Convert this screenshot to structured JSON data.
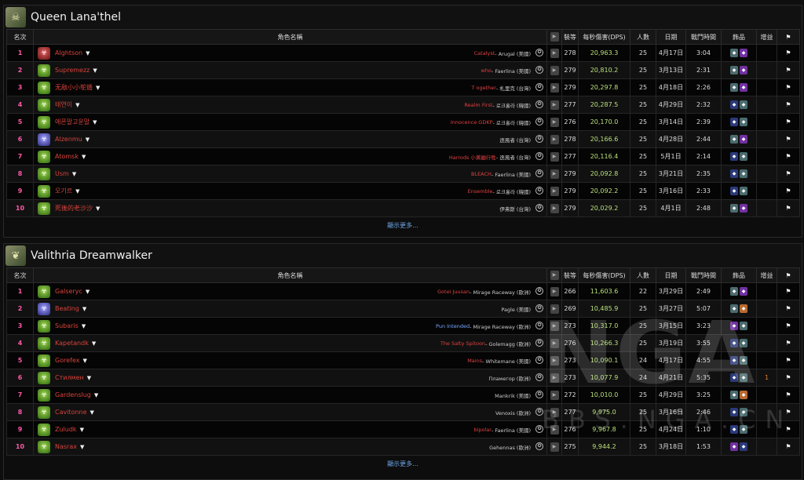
{
  "columns": {
    "rank": "名次",
    "name": "角色名稱",
    "video_icon": "youtube-icon",
    "ilvl": "裝等",
    "dps": "每秒傷害(DPS)",
    "players": "人數",
    "date": "日期",
    "duration": "戰鬥時間",
    "trinkets": "飾品",
    "buff": "增益",
    "flag_icon": "flag-icon"
  },
  "show_more": "顯示更多...",
  "watermark": {
    "big": "NGA",
    "small": "BBS.NGA.CN"
  },
  "bosses": [
    {
      "title": "Queen Lana'thel",
      "rows": [
        {
          "rank": "1",
          "name": "Alghtson",
          "spec": "red",
          "guild": "Catalyst",
          "realm": " - Arugal (美國)",
          "ilvl": "278",
          "dps": "20,963.3",
          "players": "25",
          "date": "4月17日",
          "duration": "3:04",
          "gems": [
            "g-teal",
            "g-purple"
          ],
          "buff": ""
        },
        {
          "rank": "2",
          "name": "Supremezz",
          "spec": "green",
          "guild": "who",
          "realm": " - Faerlina (美國)",
          "ilvl": "279",
          "dps": "20,810.2",
          "players": "25",
          "date": "3月13日",
          "duration": "2:31",
          "gems": [
            "g-teal",
            "g-purple"
          ],
          "buff": ""
        },
        {
          "rank": "3",
          "name": "无敌小小鸵循",
          "spec": "green",
          "guild": "T ogether",
          "realm": " - 札里克 (台灣)",
          "ilvl": "279",
          "dps": "20,297.8",
          "players": "25",
          "date": "4月18日",
          "duration": "2:26",
          "gems": [
            "g-teal",
            "g-purple"
          ],
          "buff": ""
        },
        {
          "rank": "4",
          "name": "태연이",
          "spec": "green",
          "guild": "Realm First",
          "realm": " - 로크홀라 (韓國)",
          "ilvl": "277",
          "dps": "20,287.5",
          "players": "25",
          "date": "4月29日",
          "duration": "2:32",
          "gems": [
            "g-blue",
            "g-teal"
          ],
          "buff": ""
        },
        {
          "rank": "5",
          "name": "에픈말고운말",
          "spec": "green",
          "guild": "Innocence GDKP",
          "realm": " - 로크홀라 (韓國)",
          "ilvl": "276",
          "dps": "20,170.0",
          "players": "25",
          "date": "3月14日",
          "duration": "2:39",
          "gems": [
            "g-blue",
            "g-teal"
          ],
          "buff": ""
        },
        {
          "rank": "6",
          "name": "Alzenmu",
          "spec": "blue",
          "guild": "",
          "realm": "逐風者 (台灣)",
          "ilvl": "278",
          "dps": "20,166.6",
          "players": "25",
          "date": "4月28日",
          "duration": "2:44",
          "gems": [
            "g-teal",
            "g-purple"
          ],
          "buff": ""
        },
        {
          "rank": "7",
          "name": "Atomsk",
          "spec": "green",
          "guild": "Harrods 小黃鼬行牲",
          "realm": " - 逐風者 (台灣)",
          "ilvl": "277",
          "dps": "20,116.4",
          "players": "25",
          "date": "5月1日",
          "duration": "2:14",
          "gems": [
            "g-blue",
            "g-teal"
          ],
          "buff": ""
        },
        {
          "rank": "8",
          "name": "Usm",
          "spec": "green",
          "guild": "BLEACH",
          "realm": " - Faerlina (美國)",
          "ilvl": "279",
          "dps": "20,092.8",
          "players": "25",
          "date": "3月21日",
          "duration": "2:35",
          "gems": [
            "g-blue",
            "g-teal"
          ],
          "buff": ""
        },
        {
          "rank": "9",
          "name": "오기르",
          "spec": "green",
          "guild": "Ensemble",
          "realm": " - 로크홀라 (韓國)",
          "ilvl": "279",
          "dps": "20,092.2",
          "players": "25",
          "date": "3月16日",
          "duration": "2:33",
          "gems": [
            "g-blue",
            "g-teal"
          ],
          "buff": ""
        },
        {
          "rank": "10",
          "name": "死後的老沙沙",
          "spec": "green",
          "guild": "",
          "realm": "伊弗斯 (台灣)",
          "ilvl": "279",
          "dps": "20,029.2",
          "players": "25",
          "date": "4月1日",
          "duration": "2:48",
          "gems": [
            "g-teal",
            "g-purple"
          ],
          "buff": ""
        }
      ]
    },
    {
      "title": "Valithria Dreamwalker",
      "rows": [
        {
          "rank": "1",
          "name": "Galseryc",
          "spec": "green",
          "guild": "Gotei Juusan",
          "realm": " - Mirage Raceway (歐洲)",
          "ilvl": "266",
          "dps": "11,603.6",
          "players": "22",
          "date": "3月29日",
          "duration": "2:49",
          "gems": [
            "g-teal",
            "g-purple"
          ],
          "buff": ""
        },
        {
          "rank": "2",
          "name": "Beating",
          "spec": "blue",
          "guild": "",
          "realm": "Pagle (美國)",
          "ilvl": "269",
          "dps": "10,485.9",
          "players": "25",
          "date": "3月27日",
          "duration": "5:07",
          "gems": [
            "g-teal",
            "g-orange"
          ],
          "buff": ""
        },
        {
          "rank": "3",
          "name": "Subaris",
          "spec": "green",
          "guild": "Pun Intended",
          "guild_class": "blue",
          "realm": " - Mirage Raceway (歐洲)",
          "ilvl": "273",
          "dps": "10,317.0",
          "players": "25",
          "date": "3月15日",
          "duration": "3:23",
          "gems": [
            "g-purple",
            "g-teal"
          ],
          "buff": ""
        },
        {
          "rank": "4",
          "name": "Kapetandk",
          "spec": "green",
          "guild": "The Salty Spitoon",
          "realm": " - Golemagg (歐洲)",
          "ilvl": "276",
          "dps": "10,266.3",
          "players": "25",
          "date": "3月19日",
          "duration": "3:55",
          "gems": [
            "g-blue",
            "g-teal"
          ],
          "buff": ""
        },
        {
          "rank": "5",
          "name": "Gorefex",
          "spec": "green",
          "guild": "Mains",
          "realm": " - Whitemane (美國)",
          "ilvl": "273",
          "dps": "10,090.1",
          "players": "24",
          "date": "4月17日",
          "duration": "4:55",
          "gems": [
            "g-blue",
            "g-teal"
          ],
          "buff": ""
        },
        {
          "rank": "6",
          "name": "Стилмен",
          "spec": "green",
          "guild": "",
          "realm": "Пламегор (歐洲)",
          "ilvl": "273",
          "dps": "10,077.9",
          "players": "24",
          "date": "4月21日",
          "duration": "5:35",
          "gems": [
            "g-blue",
            "g-teal"
          ],
          "buff": "1"
        },
        {
          "rank": "7",
          "name": "Gardenslug",
          "spec": "green",
          "guild": "",
          "realm": "Mankrik (美國)",
          "ilvl": "272",
          "dps": "10,010.0",
          "players": "25",
          "date": "4月29日",
          "duration": "3:25",
          "gems": [
            "g-teal",
            "g-orange"
          ],
          "buff": ""
        },
        {
          "rank": "8",
          "name": "Cavitonne",
          "spec": "green",
          "guild": "",
          "realm": "Venoxis (歐洲)",
          "ilvl": "277",
          "dps": "9,975.0",
          "players": "25",
          "date": "3月16日",
          "duration": "2:46",
          "gems": [
            "g-blue",
            "g-teal"
          ],
          "buff": ""
        },
        {
          "rank": "9",
          "name": "Zuludk",
          "spec": "green",
          "guild": "bipolar",
          "realm": " - Faerlina (美國)",
          "ilvl": "276",
          "dps": "9,967.8",
          "players": "25",
          "date": "4月24日",
          "duration": "1:10",
          "gems": [
            "g-blue",
            "g-teal"
          ],
          "buff": ""
        },
        {
          "rank": "10",
          "name": "Nasrax",
          "spec": "green",
          "guild": "",
          "realm": "Gehennas (歐洲)",
          "ilvl": "275",
          "dps": "9,944.2",
          "players": "25",
          "date": "3月18日",
          "duration": "1:53",
          "gems": [
            "g-purple",
            "g-blue"
          ],
          "buff": ""
        }
      ]
    }
  ]
}
